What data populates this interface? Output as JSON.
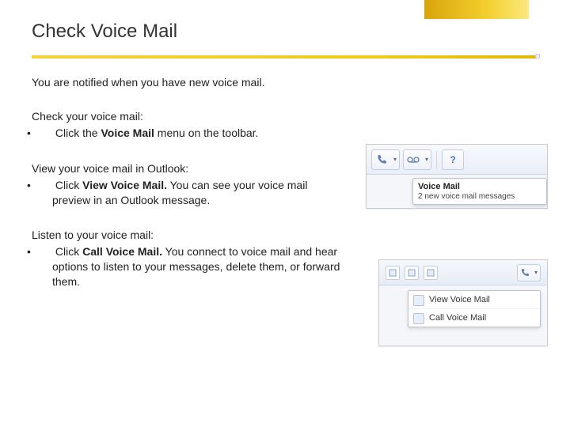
{
  "title": "Check Voice Mail",
  "intro": "You are notified when you have new voice mail.",
  "sections": {
    "check": {
      "lead": "Check your voice mail:",
      "bullet_pre": "Click the ",
      "bullet_bold": "Voice Mail",
      "bullet_post": " menu on the toolbar."
    },
    "view": {
      "lead": "View your voice mail in Outlook:",
      "bullet_pre": "Click ",
      "bullet_bold": "View Voice Mail.",
      "bullet_post": " You can see your voice mail preview in an Outlook message."
    },
    "listen": {
      "lead": "Listen to your voice mail:",
      "bullet_pre": "Click ",
      "bullet_bold": "Call Voice Mail.",
      "bullet_post": " You connect to voice mail and hear options to listen to your messages, delete them, or forward them."
    }
  },
  "fig1": {
    "tooltip_title": "Voice Mail",
    "tooltip_body": "2 new voice mail messages"
  },
  "fig2": {
    "menu_view": "View Voice Mail",
    "menu_call": "Call Voice Mail"
  }
}
